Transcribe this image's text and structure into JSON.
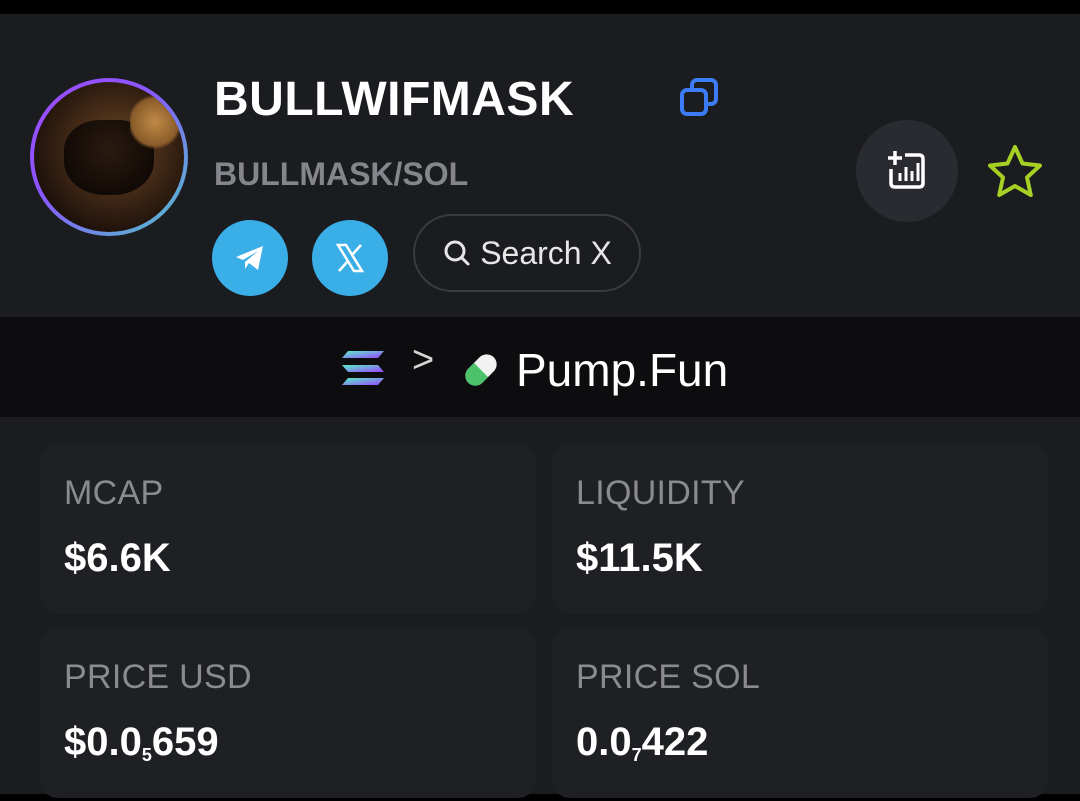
{
  "token": {
    "name": "BULLWIFMASK",
    "pair": "BULLMASK/SOL"
  },
  "icons": {
    "copy": "copy-icon",
    "telegram": "telegram-icon",
    "x": "x-icon",
    "search": "search-icon",
    "add_chart": "add-to-chart-icon",
    "favorite": "star-icon",
    "chain": "solana-icon",
    "platform": "pill-icon"
  },
  "links": {
    "search_x_label": "Search X"
  },
  "breadcrumb": {
    "separator": ">",
    "platform": "Pump.Fun"
  },
  "stats": {
    "mcap": {
      "label": "MCAP",
      "value": "$6.6K"
    },
    "liquidity": {
      "label": "LIQUIDITY",
      "value": "$11.5K"
    },
    "price_usd": {
      "label": "PRICE USD",
      "prefix": "$0.0",
      "zeros": "5",
      "digits": "659"
    },
    "price_sol": {
      "label": "PRICE SOL",
      "prefix": "0.0",
      "zeros": "7",
      "digits": "422"
    }
  },
  "colors": {
    "background": "#1b1c20",
    "card": "#1f2024",
    "social_blue": "#3aaee6",
    "copy_blue": "#3b7bf6",
    "star_green": "#a6d124",
    "label_gray": "#8a8b91"
  }
}
